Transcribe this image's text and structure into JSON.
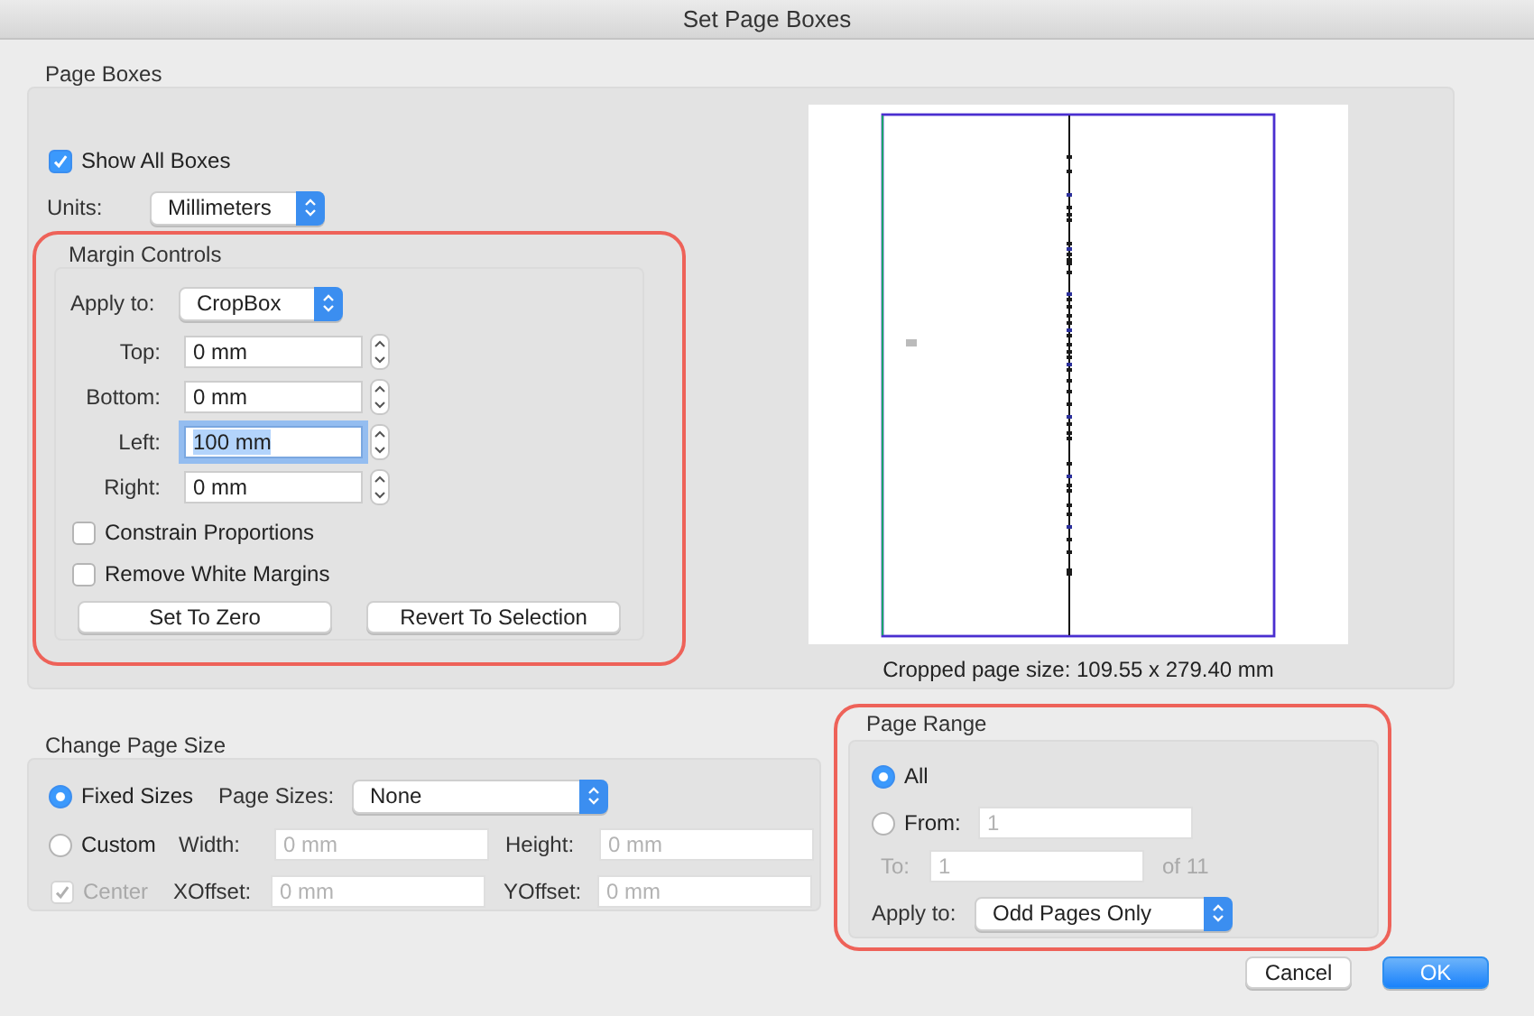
{
  "window": {
    "title": "Set Page Boxes"
  },
  "page_boxes": {
    "label": "Page Boxes",
    "show_all_boxes": {
      "label": "Show All Boxes",
      "checked": true
    },
    "units": {
      "label": "Units:",
      "value": "Millimeters"
    },
    "margin_controls": {
      "label": "Margin Controls",
      "highlighted": true,
      "apply_to": {
        "label": "Apply to:",
        "value": "CropBox"
      },
      "fields": [
        {
          "label": "Top:",
          "value": "0 mm",
          "focused": false
        },
        {
          "label": "Bottom:",
          "value": "0 mm",
          "focused": false
        },
        {
          "label": "Left:",
          "value": "100 mm",
          "focused": true
        },
        {
          "label": "Right:",
          "value": "0 mm",
          "focused": false
        }
      ],
      "checkboxes": [
        {
          "label": "Constrain Proportions",
          "checked": false
        },
        {
          "label": "Remove White Margins",
          "checked": false
        }
      ],
      "buttons": [
        "Set To Zero",
        "Revert To Selection"
      ]
    },
    "preview": {
      "caption": "Cropped page size: 109.55 x 279.40 mm"
    }
  },
  "change_page_size": {
    "label": "Change Page Size",
    "options": [
      {
        "label": "Fixed Sizes",
        "selected": true
      },
      {
        "label": "Custom",
        "selected": false
      }
    ],
    "page_sizes": {
      "label": "Page Sizes:",
      "value": "None"
    },
    "width": {
      "label": "Width:",
      "value": "0 mm",
      "disabled": true
    },
    "height": {
      "label": "Height:",
      "value": "0 mm",
      "disabled": true
    },
    "center": {
      "label": "Center",
      "checked": true,
      "disabled": true
    },
    "xoffset": {
      "label": "XOffset:",
      "value": "0 mm",
      "disabled": true
    },
    "yoffset": {
      "label": "YOffset:",
      "value": "0 mm",
      "disabled": true
    }
  },
  "page_range": {
    "label": "Page Range",
    "highlighted": true,
    "options": [
      {
        "label": "All",
        "selected": true
      },
      {
        "label": "From:",
        "selected": false
      }
    ],
    "from": {
      "value": "1",
      "disabled": true
    },
    "to": {
      "label": "To:",
      "value": "1",
      "disabled": true
    },
    "of": "of 11",
    "apply_to": {
      "label": "Apply to:",
      "value": "Odd Pages Only"
    }
  },
  "buttons": [
    {
      "label": "Cancel",
      "default": false
    },
    {
      "label": "OK",
      "default": true
    }
  ]
}
